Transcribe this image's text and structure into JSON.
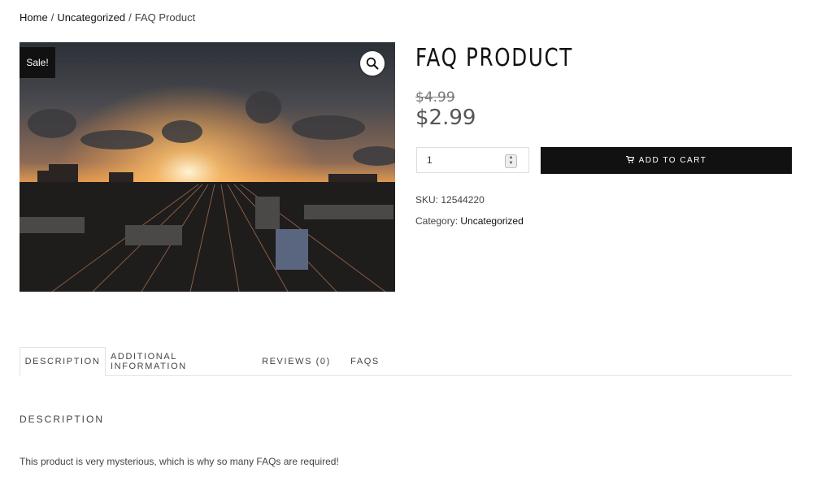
{
  "breadcrumb": {
    "home": "Home",
    "separator": "/",
    "category": "Uncategorized",
    "current": "FAQ Product"
  },
  "product": {
    "sale_badge": "Sale!",
    "title": "FAQ PRODUCT",
    "price_old": "$4.99",
    "price_new": "$2.99",
    "quantity": "1",
    "add_to_cart_label": "ADD TO CART",
    "sku_label": "SKU:",
    "sku_value": "12544220",
    "category_label": "Category:",
    "category_value": "Uncategorized"
  },
  "tabs": [
    {
      "label": "DESCRIPTION",
      "active": true
    },
    {
      "label": "ADDITIONAL INFORMATION",
      "active": false
    },
    {
      "label": "REVIEWS (0)",
      "active": false
    },
    {
      "label": "FAQS",
      "active": false
    }
  ],
  "description": {
    "heading": "DESCRIPTION",
    "text": "This product is very mysterious, which is why so many FAQs are required!"
  },
  "icons": {
    "zoom": "magnifier-icon",
    "cart": "cart-icon"
  },
  "colors": {
    "button_bg": "#111111",
    "text": "#333333"
  }
}
